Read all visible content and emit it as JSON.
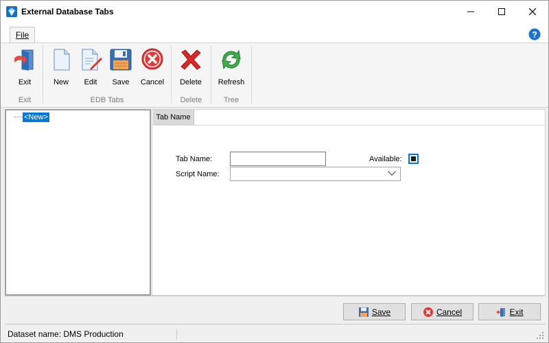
{
  "window": {
    "title": "External Database Tabs"
  },
  "ribbon_tabs": {
    "file": "File"
  },
  "ribbon": {
    "buttons": {
      "exit": "Exit",
      "new": "New",
      "edit": "Edit",
      "save": "Save",
      "cancel": "Cancel",
      "delete": "Delete",
      "refresh": "Refresh"
    },
    "groups": {
      "exit": "Exit",
      "edb_tabs": "EDB Tabs",
      "delete": "Delete",
      "tree": "Tree"
    }
  },
  "tree": {
    "nodes": [
      {
        "label": "<New>"
      }
    ]
  },
  "detail": {
    "tab": "Tab Name",
    "fields": {
      "tab_name_label": "Tab Name:",
      "tab_name_value": "",
      "script_name_label": "Script Name:",
      "script_name_value": "",
      "available_label": "Available:",
      "available_checked": true
    }
  },
  "buttons": {
    "save": "Save",
    "cancel": "Cancel",
    "exit": "Exit"
  },
  "status": {
    "dataset": "Dataset name:  DMS Production"
  },
  "colors": {
    "accent": "#0078d7",
    "selection": "#0078d7"
  },
  "icons": {
    "app": "database-icon",
    "help": "help-icon",
    "exit": "door-exit-icon",
    "new": "new-document-icon",
    "edit": "edit-document-icon",
    "save": "floppy-disk-icon",
    "cancel": "cancel-icon",
    "delete": "delete-x-icon",
    "refresh": "refresh-icon"
  }
}
